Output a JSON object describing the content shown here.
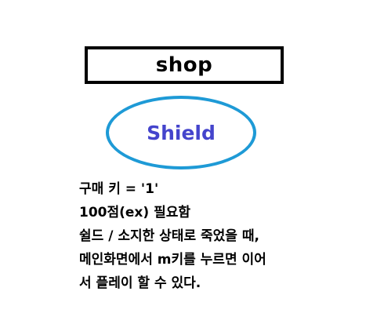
{
  "shop": {
    "title": "shop"
  },
  "item": {
    "name": "Shield",
    "oval_color": "#1e9ad6",
    "name_color": "#4444cc"
  },
  "description": {
    "lines": [
      "구매 키 = '1'",
      "100점(ex) 필요함",
      "쉴드 / 소지한 상태로 죽었을 때,",
      "메인화면에서 m키를 누르면 이어",
      "서 플레이 할 수 있다."
    ]
  }
}
